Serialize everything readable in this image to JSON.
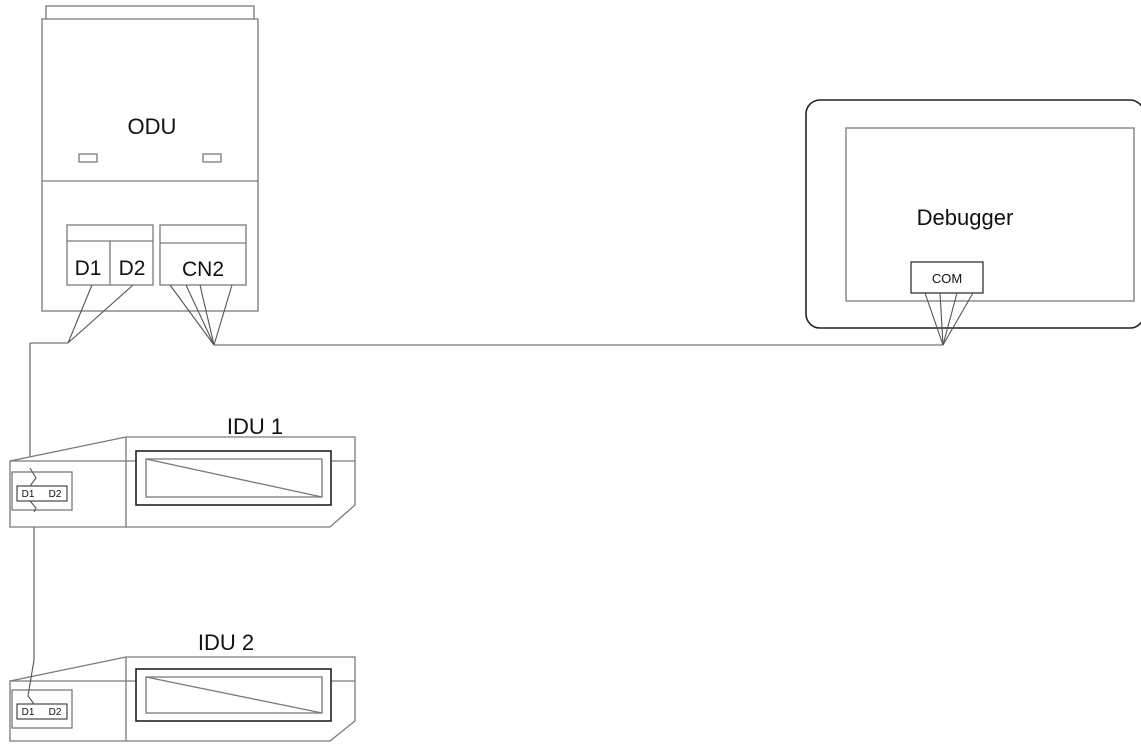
{
  "odu": {
    "label": "ODU",
    "terminals": {
      "d1": "D1",
      "d2": "D2",
      "cn2": "CN2"
    }
  },
  "debugger": {
    "label": "Debugger",
    "port": "COM"
  },
  "idus": [
    {
      "label": "IDU 1",
      "terminal_d1": "D1",
      "terminal_d2": "D2"
    },
    {
      "label": "IDU 2",
      "terminal_d1": "D1",
      "terminal_d2": "D2"
    }
  ]
}
